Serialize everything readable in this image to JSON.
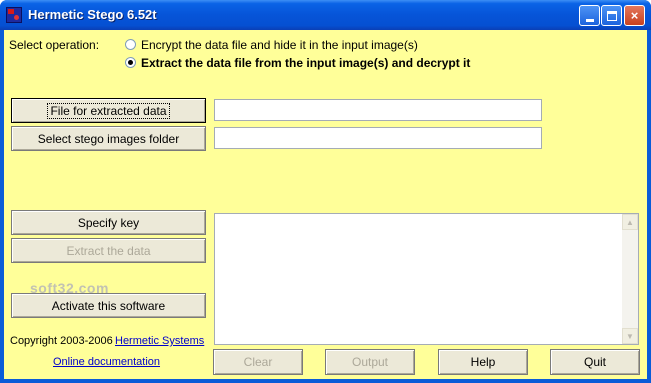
{
  "window": {
    "title": "Hermetic Stego 6.52t",
    "minimize_glyph": "minimize-icon",
    "maximize_glyph": "maximize-icon",
    "close_glyph": "×"
  },
  "operation": {
    "label": "Select operation:",
    "options": [
      {
        "label": "Encrypt the data file and hide it in the input image(s)",
        "checked": false
      },
      {
        "label": "Extract the data file from the input image(s) and decrypt it",
        "checked": true
      }
    ]
  },
  "files": {
    "extracted_button": "File for extracted data",
    "extracted_value": "",
    "stego_folder_button": "Select stego images folder",
    "stego_folder_value": ""
  },
  "actions": {
    "specify_key": "Specify key",
    "extract": "Extract the data",
    "activate": "Activate this software"
  },
  "output_text": "",
  "bottom_buttons": {
    "clear": "Clear",
    "output": "Output",
    "help": "Help",
    "quit": "Quit"
  },
  "footer": {
    "copyright": "Copyright 2003-2006",
    "company_link": "Hermetic Systems",
    "docs_link": "Online documentation"
  },
  "watermark": "soft32.com",
  "colors": {
    "client_bg": "#ffff99",
    "title_bar": "#0654d8",
    "link": "#0000cc"
  }
}
